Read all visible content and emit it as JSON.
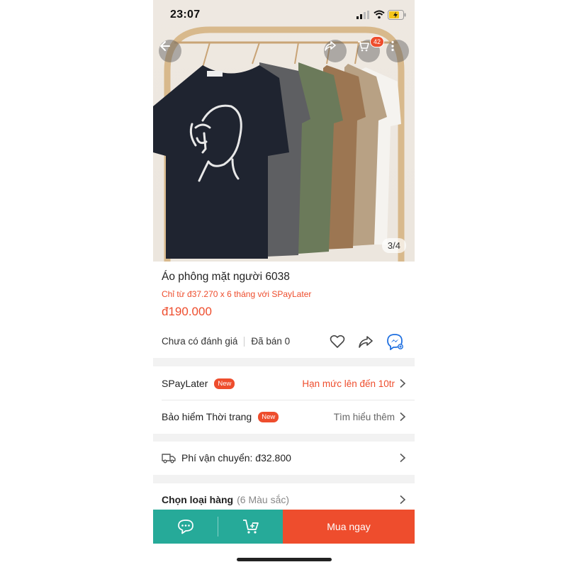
{
  "status_bar": {
    "time": "23:07"
  },
  "header": {
    "cart_count": "42"
  },
  "gallery": {
    "counter": "3/4",
    "tag_text": "5864"
  },
  "product": {
    "title": "Áo phông mặt người 6038",
    "paylater_promo": "Chỉ từ đ37.270 x 6 tháng với SPayLater",
    "price": "đ190.000",
    "rating_text": "Chưa có đánh giá",
    "sold_text": "Đã bán 0"
  },
  "rows": {
    "spaylater": {
      "label": "SPayLater",
      "badge": "New",
      "value": "Hạn mức lên đến 10tr"
    },
    "insurance": {
      "label": "Bảo hiểm Thời trang",
      "badge": "New",
      "value": "Tìm hiểu thêm"
    },
    "shipping": {
      "label": "Phí vận chuyển: đ32.800"
    },
    "variants": {
      "label": "Chọn loại hàng",
      "sub": "(6 Màu sắc)"
    }
  },
  "bottom_bar": {
    "buy_label": "Mua ngay"
  },
  "icons": [
    "back-icon",
    "share-icon",
    "cart-icon",
    "more-icon",
    "heart-icon",
    "messenger-icon",
    "truck-icon",
    "chevron-right-icon",
    "chat-icon",
    "add-to-cart-icon"
  ],
  "colors": {
    "accent": "#ee4d2d",
    "green": "#26aa99"
  }
}
